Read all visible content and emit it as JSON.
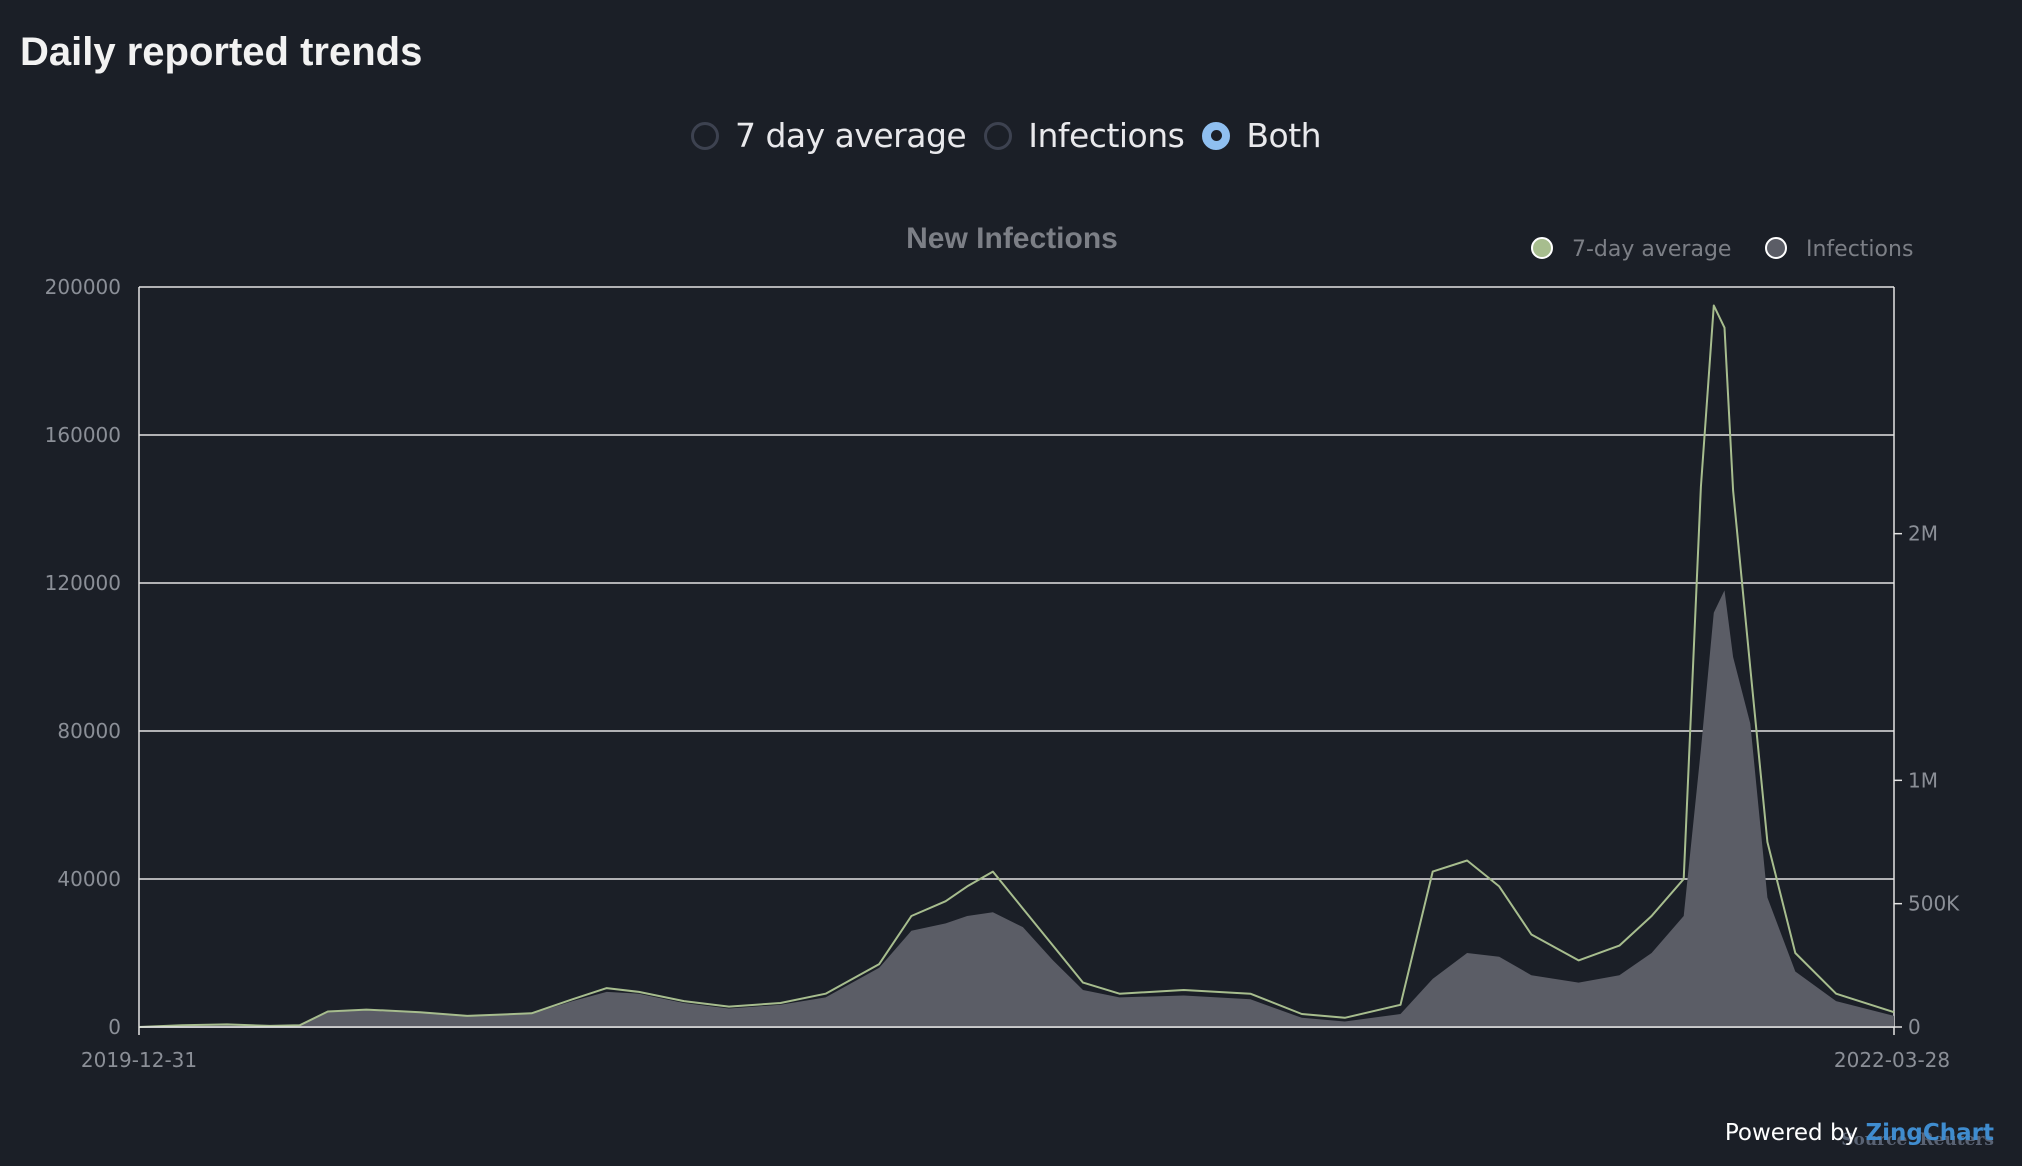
{
  "page": {
    "title": "Daily reported trends"
  },
  "view_options": {
    "selected": 2,
    "options": [
      {
        "label": "7 day average",
        "checked": false
      },
      {
        "label": "Infections",
        "checked": false
      },
      {
        "label": "Both",
        "checked": true
      }
    ]
  },
  "colors": {
    "background": "#1b1f27",
    "average_line": "#a7bd8e",
    "infections_fill": "#5b5d66",
    "gridline": "#e4e4e4",
    "axis_text": "#8b8f97",
    "radio_selected": "#8fbff0",
    "brand": "#3f8ccf"
  },
  "chart_data": {
    "type": "area",
    "title": "New Infections",
    "legend": {
      "placement": "top-right",
      "entries": [
        {
          "label": "7-day average",
          "color": "#a7bd8e"
        },
        {
          "label": "Infections",
          "color": "#5b5d66"
        }
      ]
    },
    "x": {
      "start": "2019-12-31",
      "end": "2022-03-28",
      "tick_labels": [
        "2019-12-31",
        "2022-03-28"
      ]
    },
    "y_left": {
      "range": [
        0,
        200000
      ],
      "ticks": [
        0,
        40000,
        80000,
        120000,
        160000,
        200000
      ],
      "tick_labels": [
        "0",
        "40000",
        "80000",
        "120000",
        "160000",
        "200000"
      ],
      "grid": true
    },
    "y_right": {
      "range": [
        0,
        3000000
      ],
      "ticks": [
        0,
        500000,
        1000000,
        2000000
      ],
      "tick_labels": [
        "0",
        "500K",
        "1M",
        "2M"
      ]
    },
    "series": [
      {
        "name": "Infections",
        "kind": "area",
        "points": [
          [
            "2019-12-31",
            0
          ],
          [
            "2020-01-20",
            300
          ],
          [
            "2020-02-10",
            500
          ],
          [
            "2020-03-01",
            200
          ],
          [
            "2020-03-15",
            300
          ],
          [
            "2020-03-28",
            4000
          ],
          [
            "2020-04-15",
            4500
          ],
          [
            "2020-05-10",
            3800
          ],
          [
            "2020-06-01",
            2800
          ],
          [
            "2020-07-01",
            3500
          ],
          [
            "2020-07-20",
            7000
          ],
          [
            "2020-08-05",
            9500
          ],
          [
            "2020-08-20",
            9000
          ],
          [
            "2020-09-10",
            6500
          ],
          [
            "2020-10-01",
            5000
          ],
          [
            "2020-10-25",
            6000
          ],
          [
            "2020-11-15",
            8000
          ],
          [
            "2020-12-10",
            16000
          ],
          [
            "2020-12-25",
            26000
          ],
          [
            "2021-01-10",
            28000
          ],
          [
            "2021-01-20",
            30000
          ],
          [
            "2021-02-01",
            31000
          ],
          [
            "2021-02-15",
            27000
          ],
          [
            "2021-03-01",
            18000
          ],
          [
            "2021-03-15",
            10000
          ],
          [
            "2021-04-01",
            8000
          ],
          [
            "2021-05-01",
            8500
          ],
          [
            "2021-06-01",
            7500
          ],
          [
            "2021-06-25",
            2500
          ],
          [
            "2021-07-15",
            1500
          ],
          [
            "2021-08-10",
            3500
          ],
          [
            "2021-08-25",
            13000
          ],
          [
            "2021-09-10",
            20000
          ],
          [
            "2021-09-25",
            19000
          ],
          [
            "2021-10-10",
            14000
          ],
          [
            "2021-11-01",
            12000
          ],
          [
            "2021-11-20",
            14000
          ],
          [
            "2021-12-05",
            20000
          ],
          [
            "2021-12-20",
            30000
          ],
          [
            "2021-12-28",
            75000
          ],
          [
            "2022-01-03",
            112000
          ],
          [
            "2022-01-08",
            118000
          ],
          [
            "2022-01-12",
            100000
          ],
          [
            "2022-01-20",
            82000
          ],
          [
            "2022-01-28",
            35000
          ],
          [
            "2022-02-10",
            15000
          ],
          [
            "2022-03-01",
            7000
          ],
          [
            "2022-03-28",
            3000
          ]
        ]
      },
      {
        "name": "7-day average",
        "kind": "line",
        "points": [
          [
            "2019-12-31",
            0
          ],
          [
            "2020-01-20",
            500
          ],
          [
            "2020-02-10",
            700
          ],
          [
            "2020-03-01",
            300
          ],
          [
            "2020-03-15",
            500
          ],
          [
            "2020-03-28",
            4200
          ],
          [
            "2020-04-15",
            4700
          ],
          [
            "2020-05-10",
            4000
          ],
          [
            "2020-06-01",
            3000
          ],
          [
            "2020-07-01",
            3700
          ],
          [
            "2020-07-20",
            7500
          ],
          [
            "2020-08-05",
            10500
          ],
          [
            "2020-08-20",
            9500
          ],
          [
            "2020-09-10",
            7000
          ],
          [
            "2020-10-01",
            5500
          ],
          [
            "2020-10-25",
            6500
          ],
          [
            "2020-11-15",
            9000
          ],
          [
            "2020-12-10",
            17000
          ],
          [
            "2020-12-25",
            30000
          ],
          [
            "2021-01-10",
            34000
          ],
          [
            "2021-01-20",
            38000
          ],
          [
            "2021-02-01",
            42000
          ],
          [
            "2021-02-15",
            32000
          ],
          [
            "2021-03-01",
            22000
          ],
          [
            "2021-03-15",
            12000
          ],
          [
            "2021-04-01",
            9000
          ],
          [
            "2021-05-01",
            10000
          ],
          [
            "2021-06-01",
            9000
          ],
          [
            "2021-06-25",
            3500
          ],
          [
            "2021-07-15",
            2500
          ],
          [
            "2021-08-10",
            6000
          ],
          [
            "2021-08-25",
            42000
          ],
          [
            "2021-09-10",
            45000
          ],
          [
            "2021-09-25",
            38000
          ],
          [
            "2021-10-10",
            25000
          ],
          [
            "2021-11-01",
            18000
          ],
          [
            "2021-11-20",
            22000
          ],
          [
            "2021-12-05",
            30000
          ],
          [
            "2021-12-20",
            40000
          ],
          [
            "2021-12-28",
            146000
          ],
          [
            "2022-01-03",
            195000
          ],
          [
            "2022-01-08",
            189000
          ],
          [
            "2022-01-12",
            145000
          ],
          [
            "2022-01-20",
            97000
          ],
          [
            "2022-01-28",
            50000
          ],
          [
            "2022-02-10",
            20000
          ],
          [
            "2022-03-01",
            9000
          ],
          [
            "2022-03-28",
            4000
          ]
        ]
      }
    ]
  },
  "footer": {
    "powered_prefix": "Powered by ",
    "powered_brand": "ZingChart",
    "source": "Source: Reuters"
  }
}
